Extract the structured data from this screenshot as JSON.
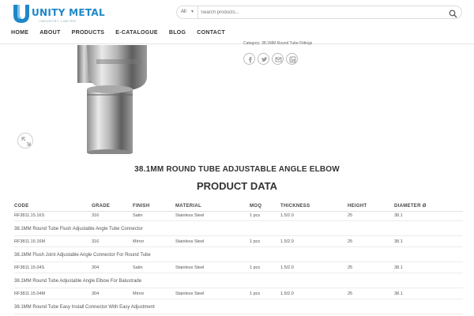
{
  "header": {
    "logo": {
      "title": "UNITY METAL",
      "subtitle": "INDUSTRY LIMITED"
    },
    "search": {
      "category": "All",
      "placeholder": "Search products..."
    },
    "nav": [
      "HOME",
      "ABOUT",
      "PRODUCTS",
      "E-CATALOGUE",
      "BLOG",
      "CONTACT"
    ]
  },
  "product": {
    "category_text": "Category: 38.1MM Round Tube Fittings",
    "title": "38.1MM ROUND TUBE ADJUSTABLE ANGLE ELBOW",
    "share_icons": [
      "facebook-icon",
      "twitter-icon",
      "email-icon",
      "linkedin-icon"
    ]
  },
  "product_data": {
    "title": "PRODUCT DATA",
    "columns": [
      "CODE",
      "GRADE",
      "FINISH",
      "MATERIAL",
      "MOQ",
      "THICKNESS",
      "HEIGHT",
      "DIAMETER Ø"
    ],
    "rows": [
      {
        "cells": [
          "RF3811.15.16S",
          "316",
          "Satin",
          "Stainless Steel",
          "1 pcs",
          "1.5/2.0",
          "25",
          "38.1"
        ],
        "desc": "38.1MM Round Tube Flush Adjustable Angle Tube Connector"
      },
      {
        "cells": [
          "RF3811.15.16M",
          "316",
          "Mirror",
          "Stainless Steel",
          "1 pcs",
          "1.5/2.0",
          "25",
          "38.1"
        ],
        "desc": "38.1MM Flush Joint Adjustable Angle Connector For Round Tube"
      },
      {
        "cells": [
          "RF3811.15.04S",
          "304",
          "Satin",
          "Stainless Steel",
          "1 pcs",
          "1.5/2.0",
          "25",
          "38.1"
        ],
        "desc": "38.1MM Round Tube Adjustable Angle Elbow For Balustrade"
      },
      {
        "cells": [
          "RF3811.15.04M",
          "304",
          "Mirror",
          "Stainless Steel",
          "1 pcs",
          "1.5/2.0",
          "25",
          "38.1"
        ],
        "desc": "38.1MM Round Tube Easy Install Connector With Easy Adjustment"
      }
    ]
  },
  "colors": {
    "brand": "#1e88c8",
    "text": "#333333"
  }
}
